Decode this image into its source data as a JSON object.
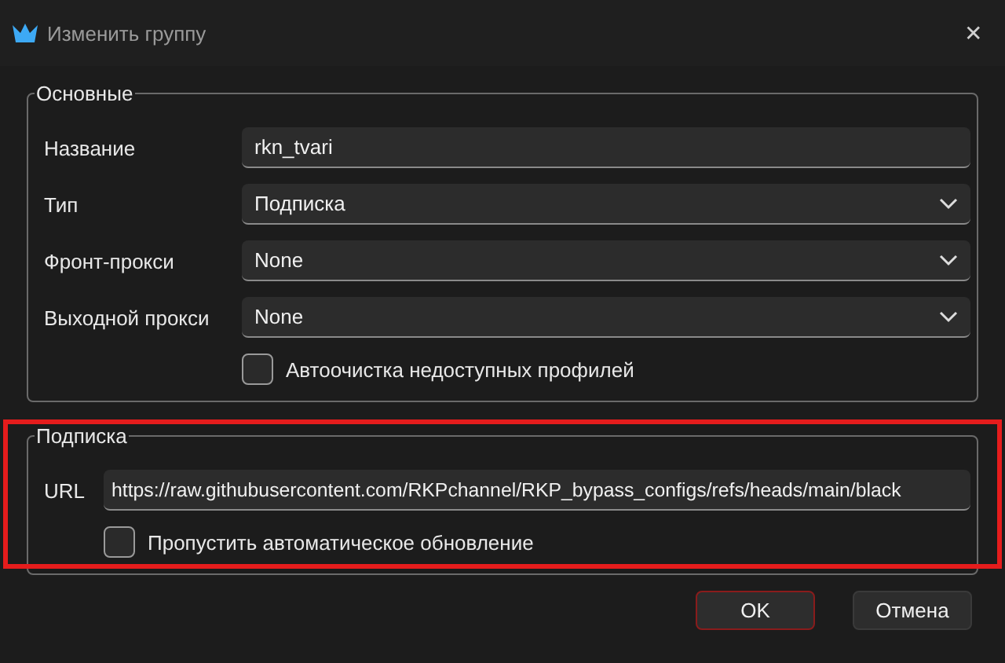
{
  "window": {
    "title": "Изменить группу",
    "close": "✕"
  },
  "groups": [
    {
      "title": "Основные",
      "rows": [
        {
          "kind": "text",
          "label": "Название",
          "value": "rkn_tvari"
        },
        {
          "kind": "select",
          "label": "Тип",
          "value": "Подписка"
        },
        {
          "kind": "select",
          "label": "Фронт-прокси",
          "value": "None"
        },
        {
          "kind": "select",
          "label": "Выходной прокси",
          "value": "None"
        },
        {
          "kind": "checkbox",
          "label": "Автоочистка недоступных профилей",
          "checked": false
        }
      ]
    },
    {
      "title": "Подписка",
      "rows": [
        {
          "kind": "text",
          "label": "URL",
          "value": "https://raw.githubusercontent.com/RKPchannel/RKP_bypass_configs/refs/heads/main/black"
        },
        {
          "kind": "checkbox",
          "label": "Пропустить автоматическое обновление",
          "checked": false
        }
      ]
    }
  ],
  "buttons": [
    {
      "label": "OK",
      "default": true
    },
    {
      "label": "Отмена",
      "default": false
    }
  ]
}
